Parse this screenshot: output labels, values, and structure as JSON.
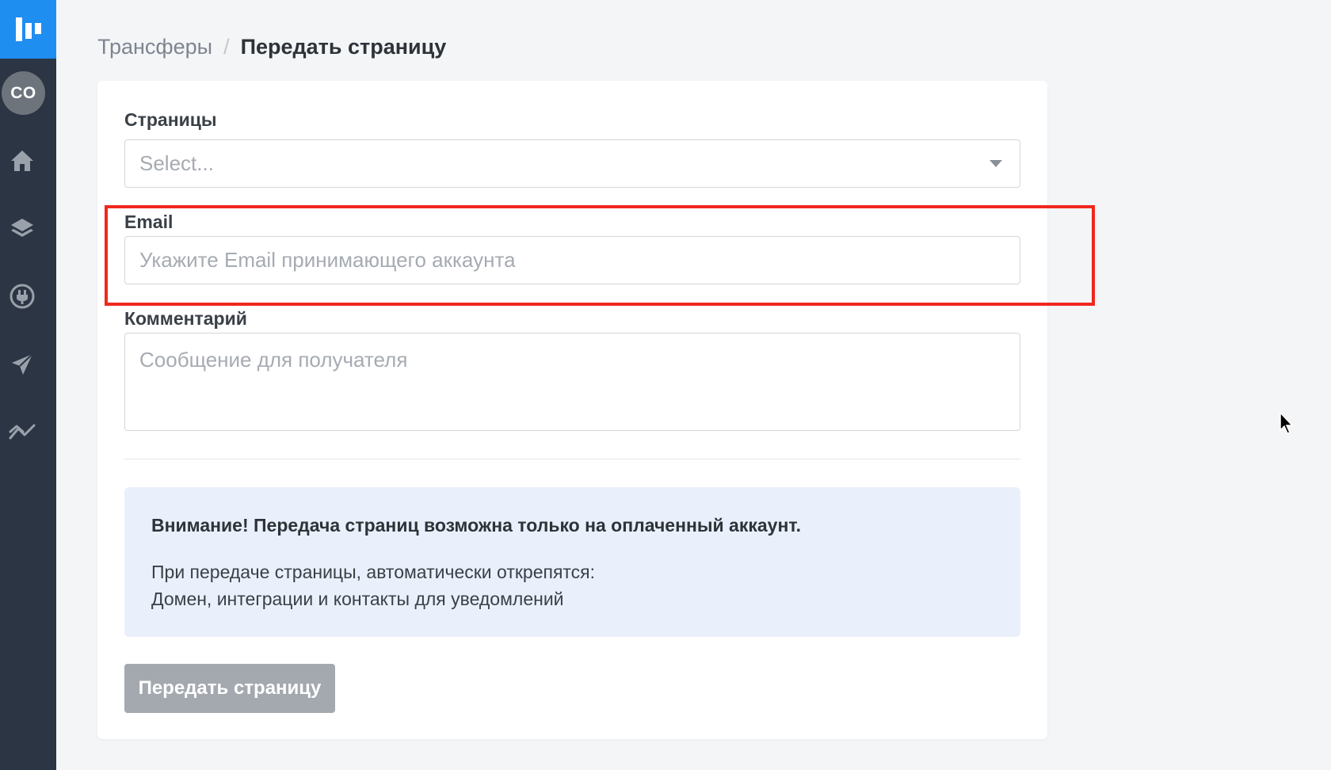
{
  "sidebar": {
    "logo_icon": "brand-logo-icon",
    "avatar_initials": "CO",
    "nav": [
      {
        "icon": "home-icon"
      },
      {
        "icon": "layers-icon"
      },
      {
        "icon": "plug-icon"
      },
      {
        "icon": "send-icon"
      },
      {
        "icon": "analytics-icon"
      }
    ]
  },
  "breadcrumb": {
    "parent": "Трансферы",
    "separator": "/",
    "current": "Передать страницу"
  },
  "form": {
    "pages": {
      "label": "Страницы",
      "placeholder": "Select..."
    },
    "email": {
      "label": "Email",
      "placeholder": "Укажите Email принимающего аккаунта",
      "value": ""
    },
    "comment": {
      "label": "Комментарий",
      "placeholder": "Сообщение для получателя",
      "value": ""
    }
  },
  "notice": {
    "title": "Внимание! Передача страниц возможна только на оплаченный аккаунт.",
    "line1": "При передаче страницы, автоматически открепятся:",
    "line2": "Домен, интеграции и контакты для уведомлений"
  },
  "submit_label": "Передать страницу",
  "colors": {
    "sidebar": "#2b3544",
    "logo": "#1f8ef1",
    "notice_bg": "#eaf0fb",
    "button_disabled": "#a4a9af",
    "highlight": "#f0281e"
  }
}
